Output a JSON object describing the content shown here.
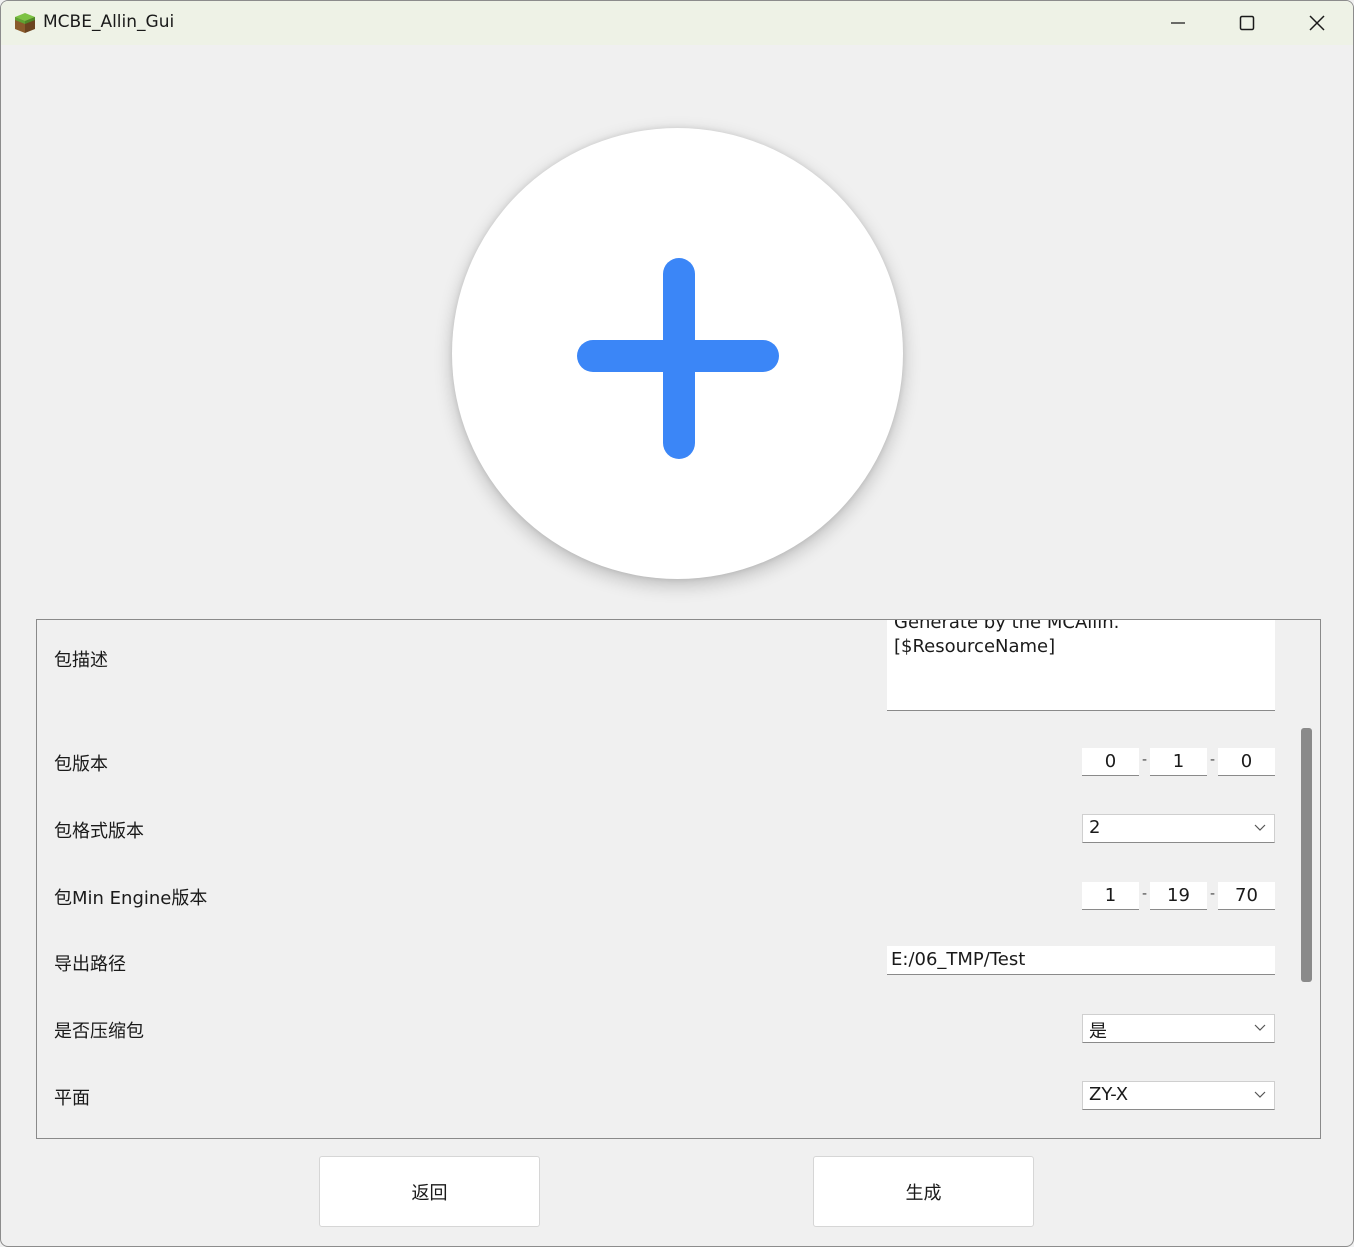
{
  "window": {
    "title": "MCBE_Allin_Gui",
    "icon": "grass-block-icon",
    "controls": [
      "minimize-icon",
      "maximize-icon",
      "close-icon"
    ]
  },
  "add_button": {
    "icon": "plus-icon",
    "color": "#3b86f7"
  },
  "form": {
    "description": {
      "label": "包描述",
      "line1": "Generate by the MCAllin.",
      "line2": "[$ResourceName]"
    },
    "version": {
      "label": "包版本",
      "values": [
        "0",
        "1",
        "0"
      ],
      "separator": "-"
    },
    "format_version": {
      "label": "包格式版本",
      "selected": "2"
    },
    "min_engine": {
      "label": "包Min Engine版本",
      "values": [
        "1",
        "19",
        "70"
      ],
      "separator": "-"
    },
    "export_path": {
      "label": "导出路径",
      "value": "E:/06_TMP/Test"
    },
    "compress": {
      "label": "是否压缩包",
      "selected": "是"
    },
    "plane": {
      "label": "平面",
      "selected": "ZY-X"
    }
  },
  "buttons": {
    "back": "返回",
    "generate": "生成"
  }
}
